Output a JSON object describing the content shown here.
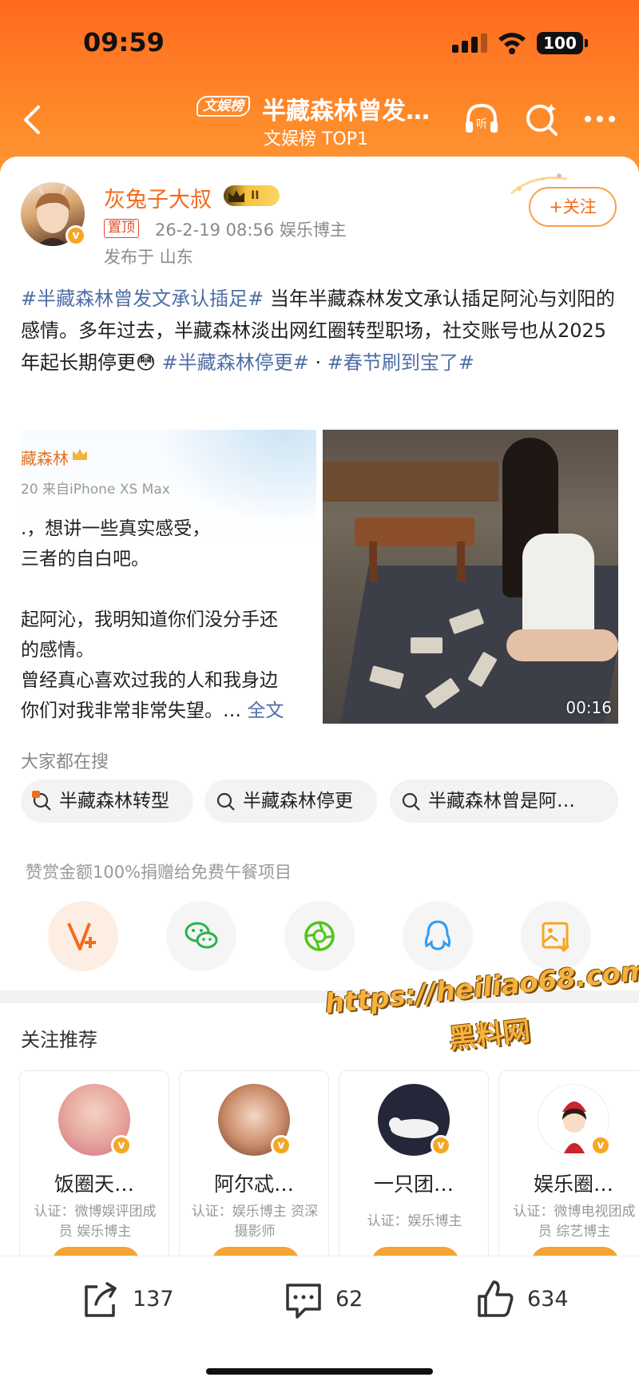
{
  "status_bar": {
    "time": "09:59",
    "battery": "100"
  },
  "nav": {
    "badge": "文娱榜",
    "title": "半藏森林曾发…",
    "subtitle": "文娱榜 TOP1"
  },
  "post": {
    "author": "灰兔子大叔",
    "level_badge": "II",
    "pinned_label": "置顶",
    "meta": "26-2-19 08:56  娱乐博主",
    "location": "发布于 山东",
    "follow_label": "+关注",
    "text": {
      "tag1": "#半藏森林曾发文承认插足#",
      "body1": " 当年半藏森林发文承认插足阿沁与刘阳的感情。多年过去，半藏森林淡出网红圈转型职场，社交账号也从2025年起长期停更",
      "emoji": "😳",
      "tag2": " #半藏森林停更#",
      "dot": " · ",
      "tag3": "#春节刷到宝了#"
    },
    "image_left": {
      "name": "藏森林",
      "sub": "20  来自iPhone XS Max",
      "lines": [
        ".，想讲一些真实感受，",
        "三者的自白吧。",
        "",
        "起阿沁，我明知道你们没分手还",
        "的感情。",
        "曾经真心喜欢过我的人和我身边",
        "你们对我非常非常失望。… "
      ],
      "more": "全文"
    },
    "video_duration": "00:16"
  },
  "search": {
    "label": "大家都在搜",
    "chips": [
      "半藏森林转型",
      "半藏森林停更",
      "半藏森林曾是阿…"
    ]
  },
  "donate_text": "赞赏金额100%捐赠给免费午餐项目",
  "recommend": {
    "title": "关注推荐",
    "watermark_line1": "https://heiliao68.com",
    "watermark_line2": "黑料网",
    "cards": [
      {
        "name": "饭圈天…",
        "desc": "认证：微博娱评团成员 娱乐博主"
      },
      {
        "name": "阿尔忒…",
        "desc": "认证：娱乐博主 资深摄影师"
      },
      {
        "name": "一只团…",
        "desc": "认证：娱乐博主"
      },
      {
        "name": "娱乐圈…",
        "desc": "认证：微博电视团成员 综艺博主"
      }
    ]
  },
  "actions": {
    "share": "137",
    "comment": "62",
    "like": "634"
  },
  "colors": {
    "accent": "#f26b1d",
    "link": "#4f6ea6",
    "header": "#ff6a1f"
  }
}
